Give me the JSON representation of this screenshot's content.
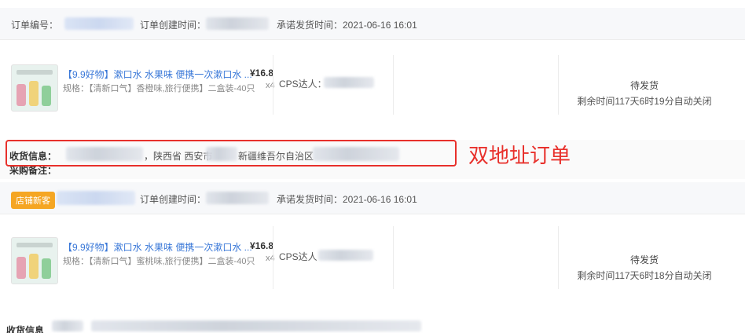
{
  "order1": {
    "order_no_label": "订单编号：",
    "created_label": "订单创建时间：",
    "promise_label": "承诺发货时间：2021-06-16 16:01",
    "product": {
      "title": "【9.9好物】漱口水 水果味 便携一次漱口水 ...",
      "spec": "规格：【清新口气】香橙味,旅行便携】二盒装-40只",
      "price": "¥16.8",
      "qty": "x4",
      "cps_label": "CPS达人："
    },
    "status": "待发货",
    "remaining": "剩余时间117天6时19分自动关闭",
    "shipping_label": "收货信息：",
    "shipping_province": "，陕西省 西安市",
    "shipping_region": "新疆维吾尔自治区",
    "remark_label": "采购备注："
  },
  "annotation": {
    "text": "双地址订单",
    "color": "#e8302b"
  },
  "order2": {
    "badge": "店铺新客",
    "created_label": "订单创建时间：",
    "promise_label": "承诺发货时间：2021-06-16 16:01",
    "product": {
      "title": "【9.9好物】漱口水 水果味 便携一次漱口水 ...",
      "spec": "规格：【清新口气】蜜桃味,旅行便携】二盒装-40只",
      "price": "¥16.8",
      "qty": "x4",
      "cps_label": "CPS达人"
    },
    "status": "待发货",
    "remaining": "剩余时间117天6时18分自动关闭",
    "shipping_label": "收货信息"
  },
  "colors": {
    "link": "#3a78d8",
    "badge": "#f5a623",
    "annotation": "#e8302b"
  }
}
